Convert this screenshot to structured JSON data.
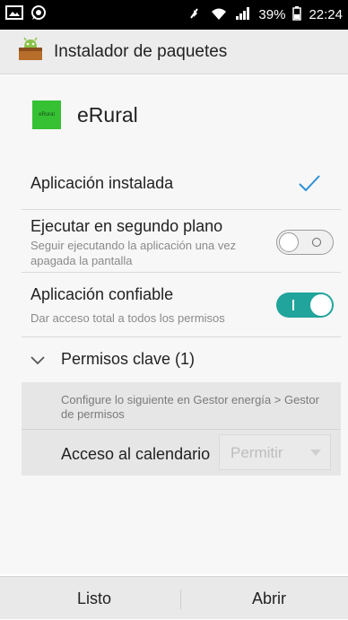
{
  "status_bar": {
    "battery_percent": "39%",
    "time": "22:24"
  },
  "app_bar": {
    "title": "Instalador de paquetes"
  },
  "app": {
    "name": "eRural",
    "icon_text": "eRural"
  },
  "installed": {
    "label": "Aplicación instalada"
  },
  "background": {
    "label": "Ejecutar en segundo plano",
    "description": "Seguir ejecutando la aplicación una vez apagada la pantalla",
    "enabled": false
  },
  "trusted": {
    "label": "Aplicación confiable",
    "description": "Dar acceso total a todos los permisos",
    "enabled": true
  },
  "permissions": {
    "header": "Permisos clave (1)",
    "note": "Configure lo siguiente en Gestor energía > Gestor de permisos",
    "items": [
      {
        "label": "Acceso al calendario",
        "value": "Permitir"
      }
    ]
  },
  "bottom": {
    "done_label": "Listo",
    "open_label": "Abrir"
  },
  "colors": {
    "accent": "#21a49b",
    "check": "#2b8fd6",
    "app_icon": "#35c133"
  }
}
